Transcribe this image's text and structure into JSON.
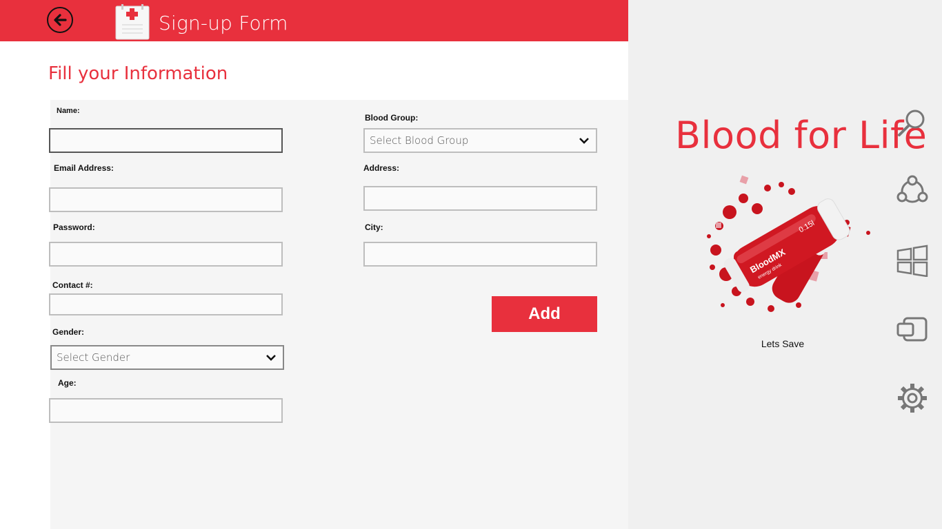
{
  "header": {
    "title": "Sign-up Form",
    "back_icon": "arrow-left-icon",
    "app_icon": "clipboard-medical-icon",
    "accent_color": "#e8303d"
  },
  "form": {
    "heading": "Fill your Information",
    "name_label": "Name:",
    "email_label": "Email Address:",
    "password_label": "Password:",
    "contact_label": "Contact #:",
    "gender_label": "Gender:",
    "gender_select": "Select Gender",
    "age_label": "Age:",
    "blood_group_label": "Blood Group:",
    "blood_group_select": "Select Blood Group",
    "address_label": "Address:",
    "city_label": "City:",
    "add_button": "Add"
  },
  "side": {
    "brand": "Blood for Life",
    "bottle_brand": "BloodMX",
    "bottle_sub": "energy drink",
    "bottle_volume": "0.15l",
    "tagline": "Lets Save"
  },
  "charms": [
    {
      "name": "search-icon"
    },
    {
      "name": "share-icon"
    },
    {
      "name": "start-icon"
    },
    {
      "name": "devices-icon"
    },
    {
      "name": "settings-icon"
    }
  ]
}
